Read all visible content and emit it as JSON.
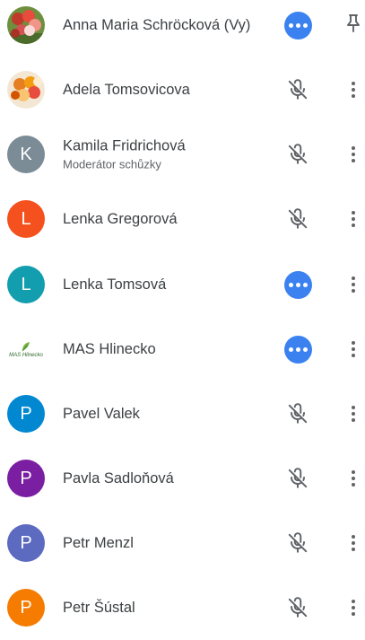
{
  "participants": [
    {
      "name": "Anna Maria Schröcková (Vy)",
      "subtitle": "",
      "avatar": {
        "type": "photo",
        "style": "tulips-red"
      },
      "status": "speaking-dots",
      "action": "pin-icon"
    },
    {
      "name": "Adela Tomsovicova",
      "subtitle": "",
      "avatar": {
        "type": "photo",
        "style": "tulips-orange"
      },
      "status": "mic-off-icon",
      "action": "more-vert-icon"
    },
    {
      "name": "Kamila Fridrichová",
      "subtitle": "Moderátor schůzky",
      "avatar": {
        "type": "letter",
        "letter": "K",
        "color": "#7b8c96"
      },
      "status": "mic-off-icon",
      "action": "more-vert-icon"
    },
    {
      "name": "Lenka Gregorová",
      "subtitle": "",
      "avatar": {
        "type": "letter",
        "letter": "L",
        "color": "#f4511e"
      },
      "status": "mic-off-icon",
      "action": "more-vert-icon"
    },
    {
      "name": "Lenka Tomsová",
      "subtitle": "",
      "avatar": {
        "type": "letter",
        "letter": "L",
        "color": "#129eaf"
      },
      "status": "speaking-dots",
      "action": "more-vert-icon"
    },
    {
      "name": "MAS Hlinecko",
      "subtitle": "",
      "avatar": {
        "type": "logo",
        "text": "MAS Hlinecko"
      },
      "status": "speaking-dots",
      "action": "more-vert-icon"
    },
    {
      "name": "Pavel Valek",
      "subtitle": "",
      "avatar": {
        "type": "letter",
        "letter": "P",
        "color": "#0288d1"
      },
      "status": "mic-off-icon",
      "action": "more-vert-icon"
    },
    {
      "name": "Pavla Sadloňová",
      "subtitle": "",
      "avatar": {
        "type": "letter",
        "letter": "P",
        "color": "#7b1fa2"
      },
      "status": "mic-off-icon",
      "action": "more-vert-icon"
    },
    {
      "name": "Petr Menzl",
      "subtitle": "",
      "avatar": {
        "type": "letter",
        "letter": "P",
        "color": "#5c6bc0"
      },
      "status": "mic-off-icon",
      "action": "more-vert-icon"
    },
    {
      "name": "Petr Šústal",
      "subtitle": "",
      "avatar": {
        "type": "letter",
        "letter": "P",
        "color": "#f57c00"
      },
      "status": "mic-off-icon",
      "action": "more-vert-icon"
    }
  ],
  "colors": {
    "speaking": "#3b82f0",
    "icon": "#5f6368",
    "text": "#3c4043"
  }
}
